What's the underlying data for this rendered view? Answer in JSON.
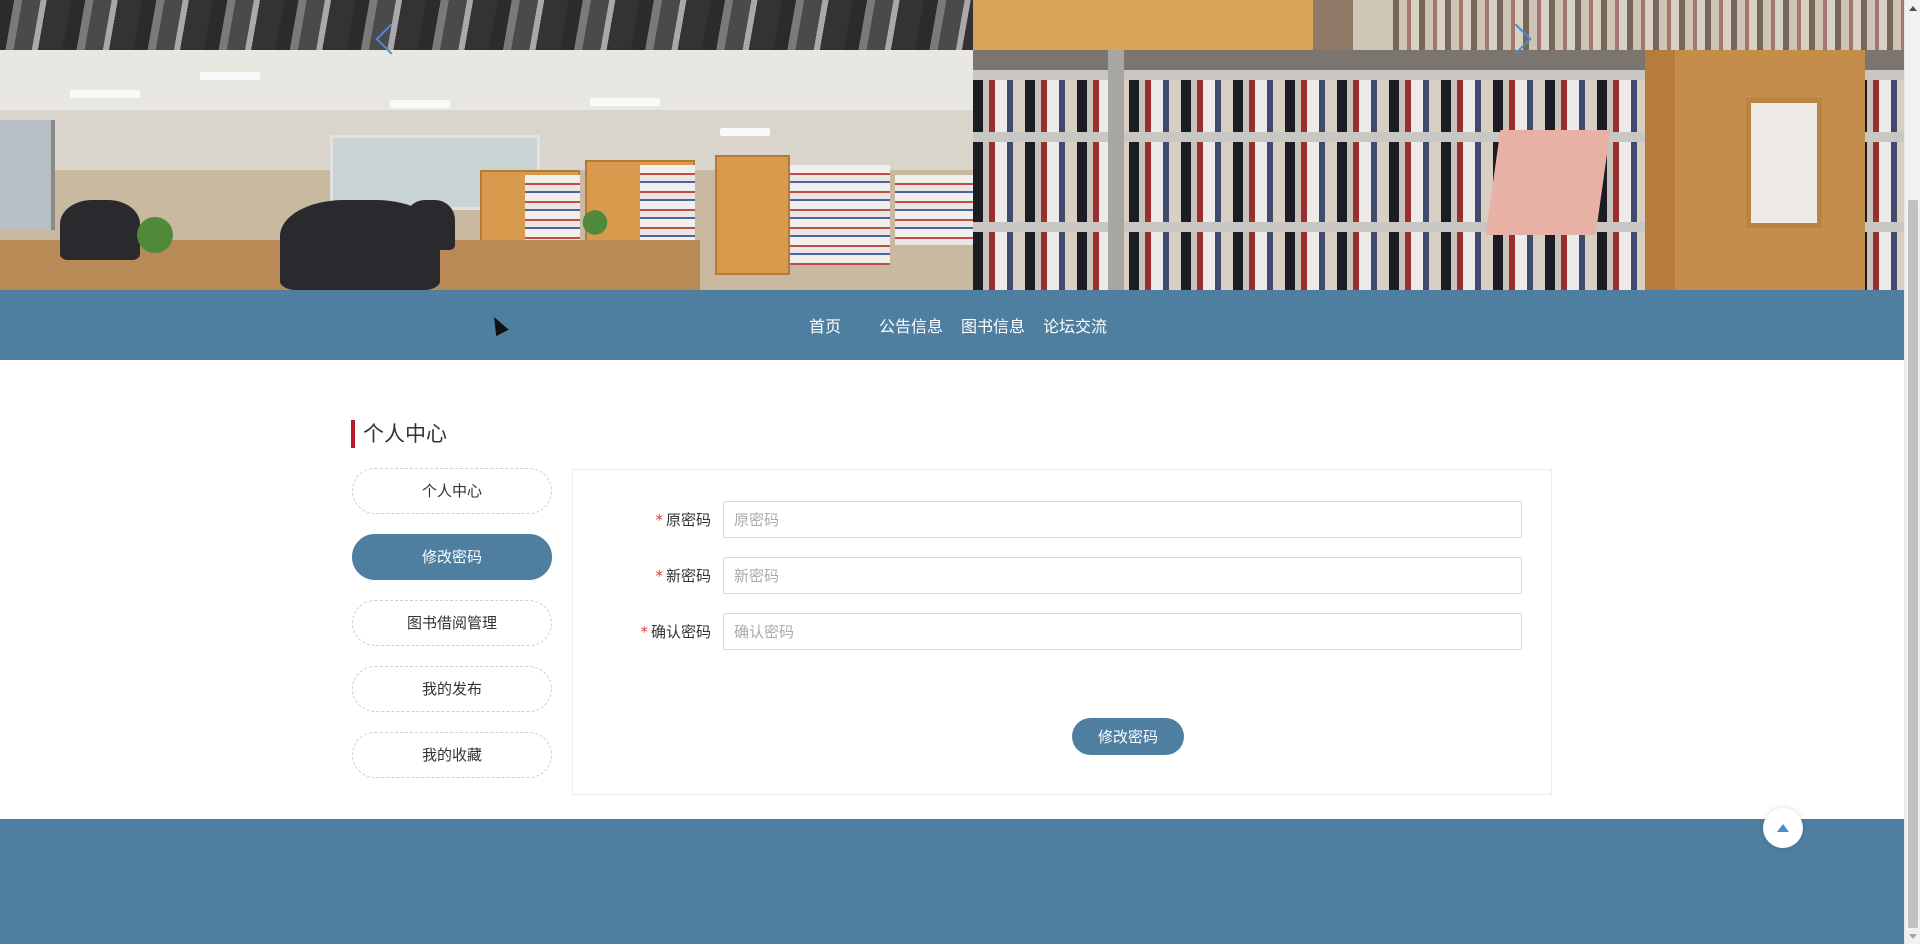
{
  "carousel": {
    "prev_icon": "chevron-left-icon",
    "next_icon": "chevron-right-icon"
  },
  "nav": {
    "items": [
      {
        "label": "首页"
      },
      {
        "label": "公告信息"
      },
      {
        "label": "图书信息"
      },
      {
        "label": "论坛交流"
      }
    ]
  },
  "page": {
    "title": "个人中心"
  },
  "sidebar": {
    "items": [
      {
        "label": "个人中心",
        "active": false
      },
      {
        "label": "修改密码",
        "active": true
      },
      {
        "label": "图书借阅管理",
        "active": false
      },
      {
        "label": "我的发布",
        "active": false
      },
      {
        "label": "我的收藏",
        "active": false
      }
    ]
  },
  "form": {
    "required_mark": "*",
    "fields": [
      {
        "label": "原密码",
        "placeholder": "原密码",
        "value": ""
      },
      {
        "label": "新密码",
        "placeholder": "新密码",
        "value": ""
      },
      {
        "label": "确认密码",
        "placeholder": "确认密码",
        "value": ""
      }
    ],
    "submit_label": "修改密码"
  },
  "footer": {
    "back_to_top_icon": "caret-up-icon"
  },
  "colors": {
    "primary": "#4e7fa0",
    "accent_bar": "#b8192c",
    "required": "#e04040",
    "arrow": "#4a8bd1"
  }
}
